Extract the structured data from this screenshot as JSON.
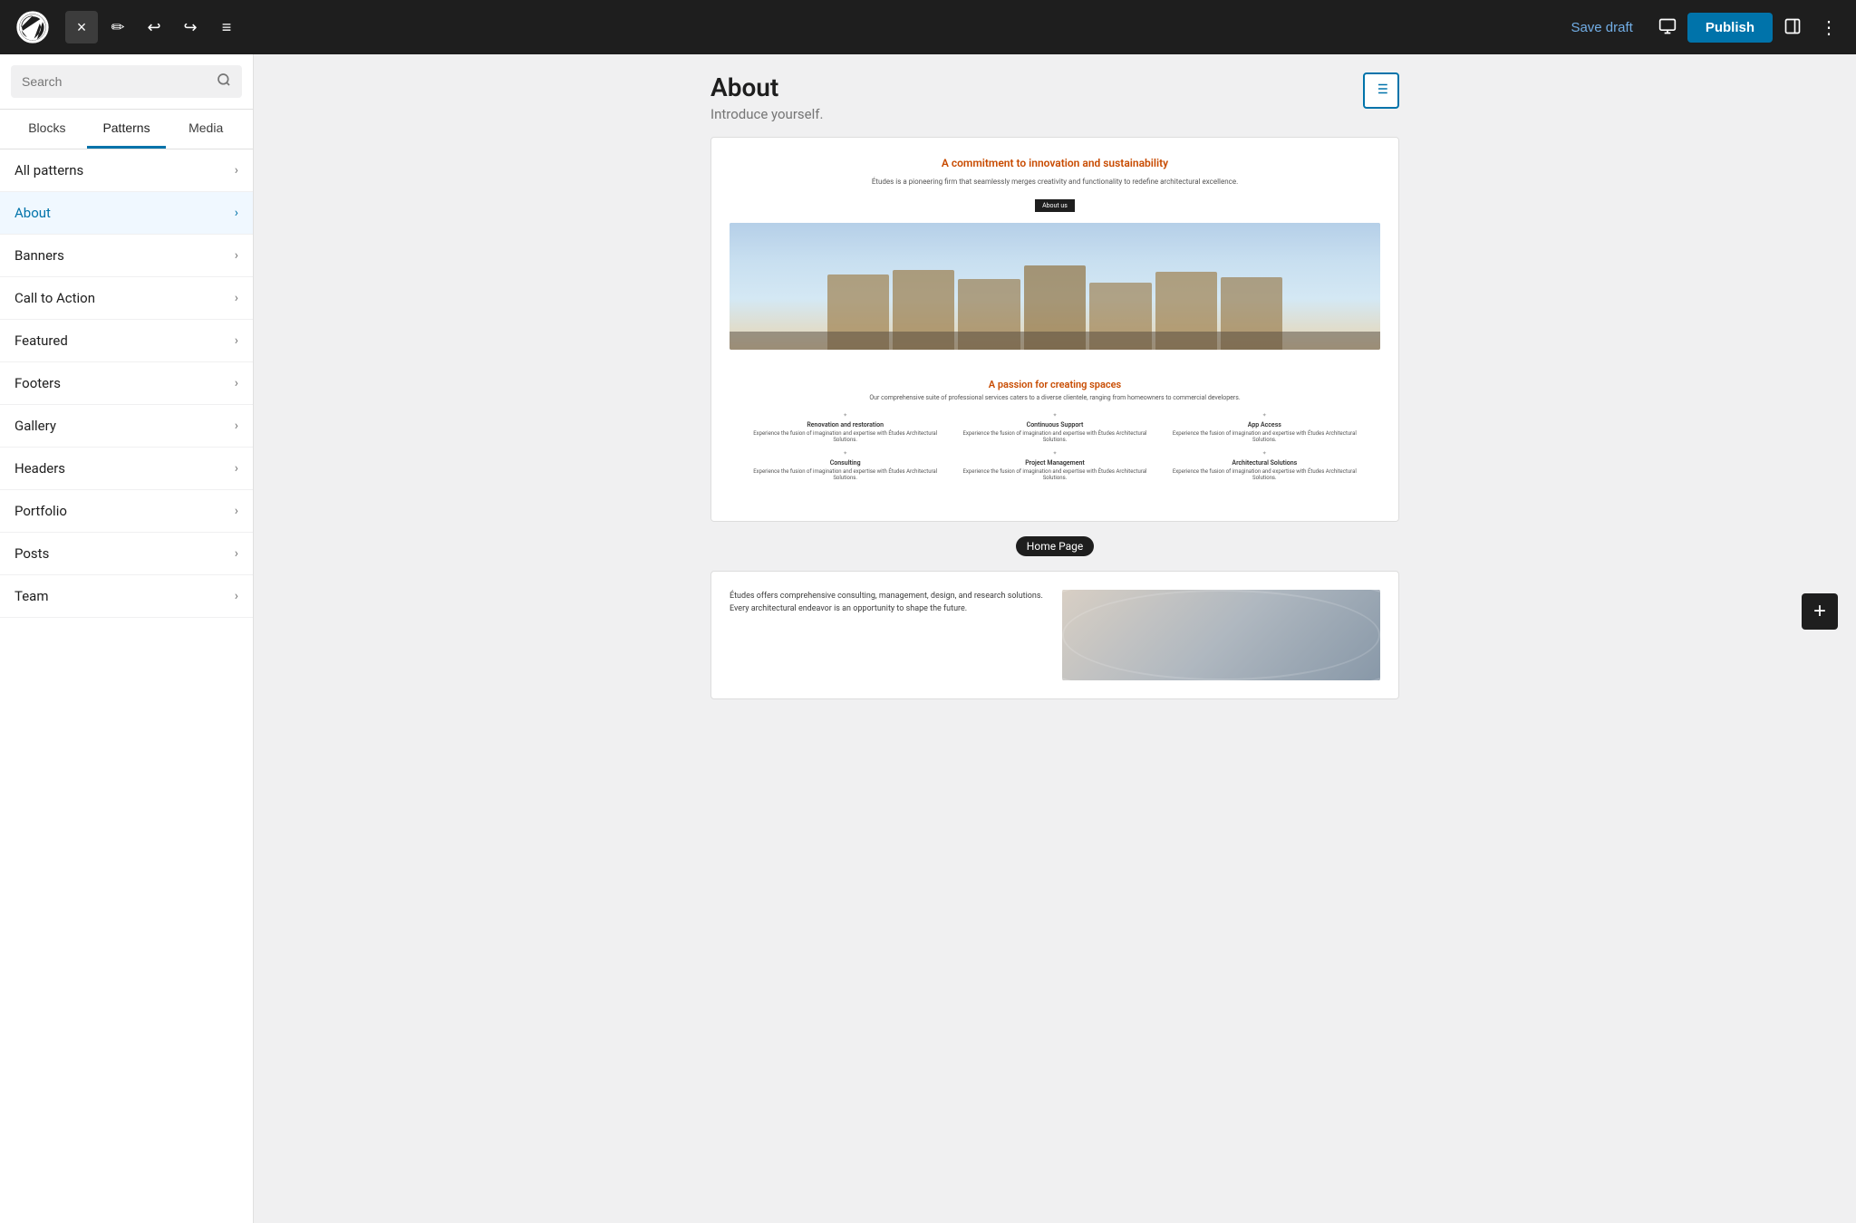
{
  "toolbar": {
    "wp_logo_label": "WordPress",
    "close_label": "×",
    "edit_label": "✏",
    "undo_label": "↩",
    "redo_label": "↪",
    "document_overview_label": "≡",
    "save_draft_label": "Save draft",
    "view_label": "⬜",
    "publish_label": "Publish",
    "sidebar_label": "⬛",
    "more_label": "⋮"
  },
  "sidebar": {
    "search_placeholder": "Search",
    "tabs": [
      {
        "id": "blocks",
        "label": "Blocks"
      },
      {
        "id": "patterns",
        "label": "Patterns"
      },
      {
        "id": "media",
        "label": "Media"
      }
    ],
    "active_tab": "patterns",
    "pattern_categories": [
      {
        "id": "all",
        "label": "All patterns",
        "active": false
      },
      {
        "id": "about",
        "label": "About",
        "active": true
      },
      {
        "id": "banners",
        "label": "Banners",
        "active": false
      },
      {
        "id": "call-to-action",
        "label": "Call to Action",
        "active": false
      },
      {
        "id": "featured",
        "label": "Featured",
        "active": false
      },
      {
        "id": "footers",
        "label": "Footers",
        "active": false
      },
      {
        "id": "gallery",
        "label": "Gallery",
        "active": false
      },
      {
        "id": "headers",
        "label": "Headers",
        "active": false
      },
      {
        "id": "portfolio",
        "label": "Portfolio",
        "active": false
      },
      {
        "id": "posts",
        "label": "Posts",
        "active": false
      },
      {
        "id": "team",
        "label": "Team",
        "active": false
      }
    ]
  },
  "preview": {
    "title": "About",
    "subtitle": "Introduce yourself.",
    "list_view_icon": "≡",
    "cards": [
      {
        "id": "home-page",
        "label": "Home Page",
        "fake_title": "A commitment to innovation and sustainability",
        "fake_desc": "Études is a pioneering firm that seamlessly merges creativity and functionality to redefine architectural excellence.",
        "fake_btn": "About us",
        "section2_title": "A passion for creating spaces",
        "section2_desc": "Our comprehensive suite of professional services caters to a diverse clientele, ranging from homeowners to commercial developers.",
        "grid_items": [
          {
            "title": "Renovation and restoration",
            "desc": "Experience the fusion of imagination and expertise with Études Architectural Solutions."
          },
          {
            "title": "Continuous Support",
            "desc": "Experience the fusion of imagination and expertise with Études Architectural Solutions."
          },
          {
            "title": "App Access",
            "desc": "Experience the fusion of imagination and expertise with Études Architectural Solutions."
          },
          {
            "title": "Consulting",
            "desc": "Experience the fusion of imagination and expertise with Études Architectural Solutions."
          },
          {
            "title": "Project Management",
            "desc": "Experience the fusion of imagination and expertise with Études Architectural Solutions."
          },
          {
            "title": "Architectural Solutions",
            "desc": "Experience the fusion of imagination and expertise with Études Architectural Solutions."
          }
        ]
      },
      {
        "id": "about-card-2",
        "label": "",
        "body_text": "Études offers comprehensive consulting, management, design, and research solutions. Every architectural endeavor is an opportunity to shape the future."
      }
    ]
  },
  "plus_button_label": "+"
}
